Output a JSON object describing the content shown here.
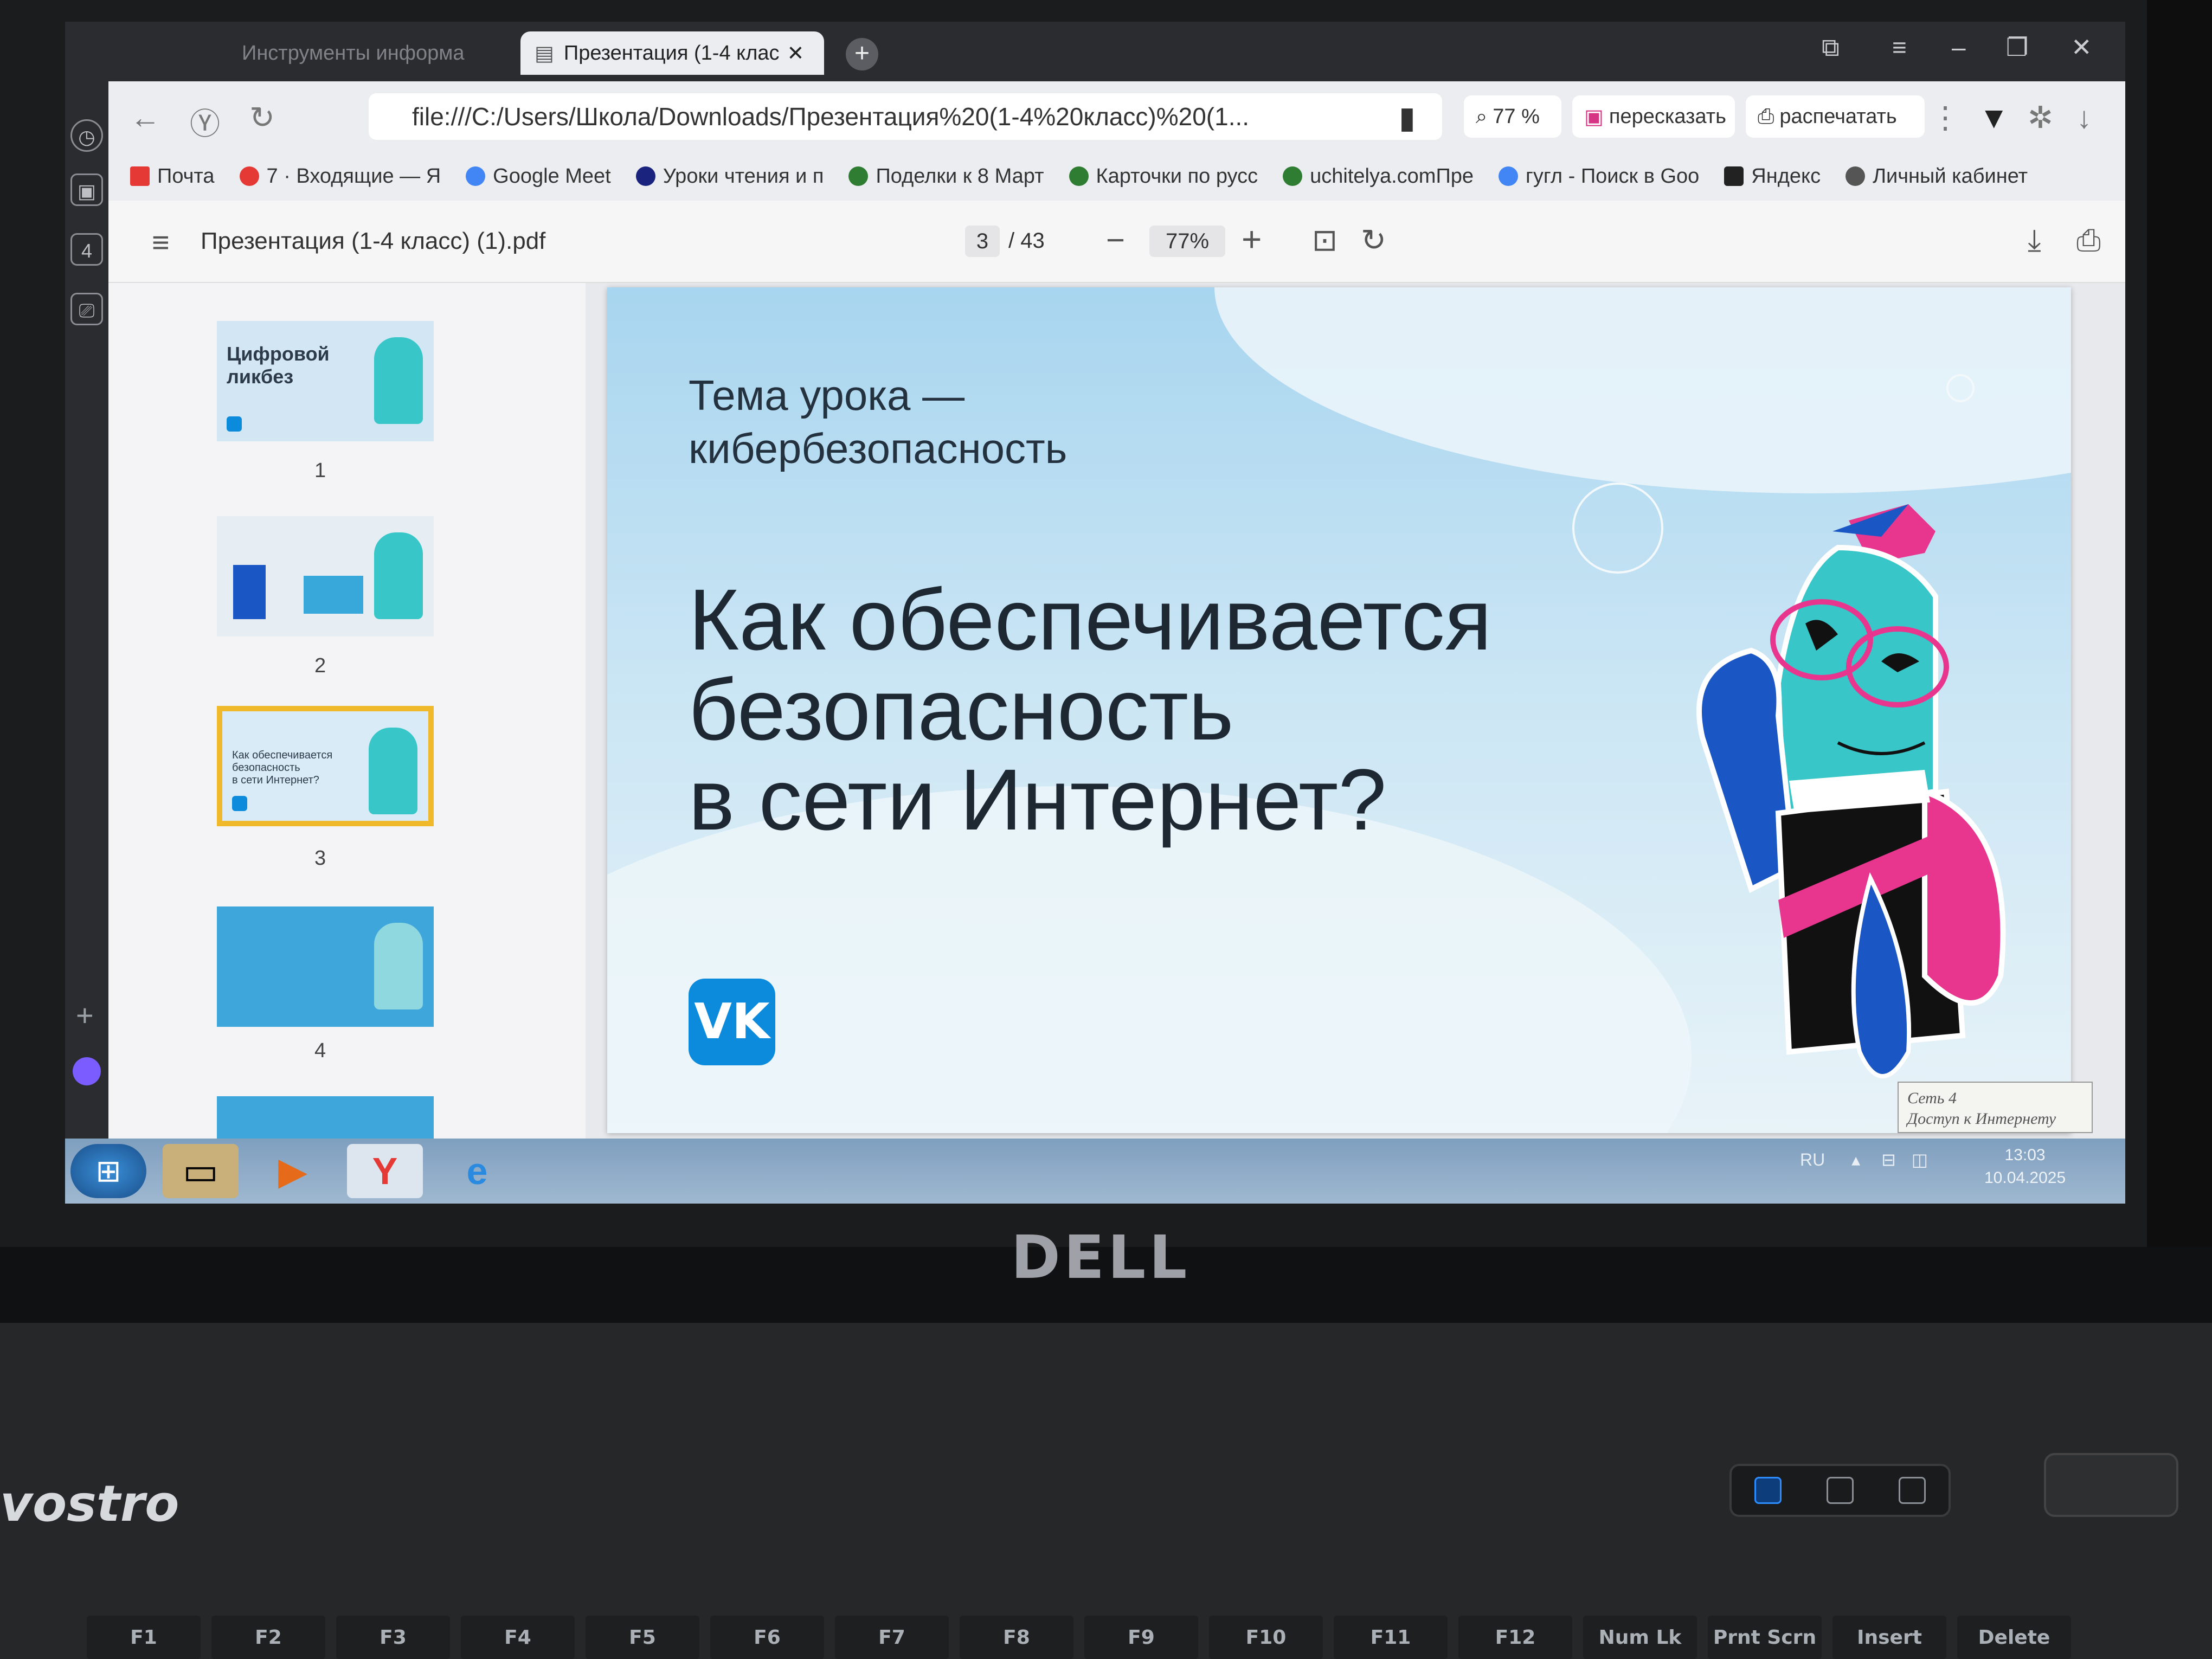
{
  "browser": {
    "tabs": [
      {
        "label": "Инструменты информа",
        "active": false
      },
      {
        "label": "Презентация (1-4 клас",
        "active": true
      }
    ],
    "new_tab": "+",
    "sidebar_badge": "4",
    "address": "file:///C:/Users/Школа/Downloads/Презентация%20(1-4%20класс)%20(1...",
    "zoom_pill": "77 %",
    "summarize": "пересказать",
    "print": "распечатать",
    "bookmarks": [
      {
        "label": "Почта",
        "color": "#e53935"
      },
      {
        "label": "7 · Входящие — Я",
        "color": "#e53935"
      },
      {
        "label": "Google Meet",
        "color": "#34a853"
      },
      {
        "label": "Уроки чтения и п",
        "color": "#1a237e"
      },
      {
        "label": "Поделки к 8 Март",
        "color": "#2e7d32"
      },
      {
        "label": "Карточки по русс",
        "color": "#2e7d32"
      },
      {
        "label": "uchitelya.comПре",
        "color": "#2e7d32"
      },
      {
        "label": "гугл - Поиск в Goo",
        "color": "#4285f4"
      },
      {
        "label": "Яндекс",
        "color": "#222222"
      },
      {
        "label": "Личный кабинет",
        "color": "#555555"
      }
    ]
  },
  "pdf": {
    "filename": "Презентация (1-4 класс) (1).pdf",
    "page_current": "3",
    "page_total": "/ 43",
    "zoom": "77%",
    "thumbnails": [
      {
        "number": "1",
        "caption": "Цифровой\nликбез"
      },
      {
        "number": "2",
        "caption": ""
      },
      {
        "number": "3",
        "caption": "Как обеспечивается\nбезопасность\nв сети Интернет?"
      },
      {
        "number": "4",
        "caption": ""
      }
    ]
  },
  "slide": {
    "kicker": "Тема урока —\nкибербезопасность",
    "headline": "Как обеспечивается\nбезопасность\nв сети Интернет?",
    "logo": "VK"
  },
  "tray": {
    "popup_line1": "Сеть 4",
    "popup_line2": "Доступ к Интернету",
    "lang": "RU",
    "time": "13:03",
    "date": "10.04.2025"
  },
  "laptop": {
    "brand": "DELL",
    "model": "vostro",
    "fkeys": [
      "F1",
      "F2",
      "F3",
      "F4",
      "F5",
      "F6",
      "F7",
      "F8",
      "F9",
      "F10",
      "F11",
      "F12",
      "Num Lk",
      "Prnt Scrn",
      "Insert",
      "Delete"
    ]
  },
  "colors": {
    "accent": "#0c8bdc",
    "highlight": "#f0b92c",
    "mascot_teal": "#38c6c9",
    "mascot_pink": "#e8368f",
    "mascot_blue": "#1a56c4"
  }
}
